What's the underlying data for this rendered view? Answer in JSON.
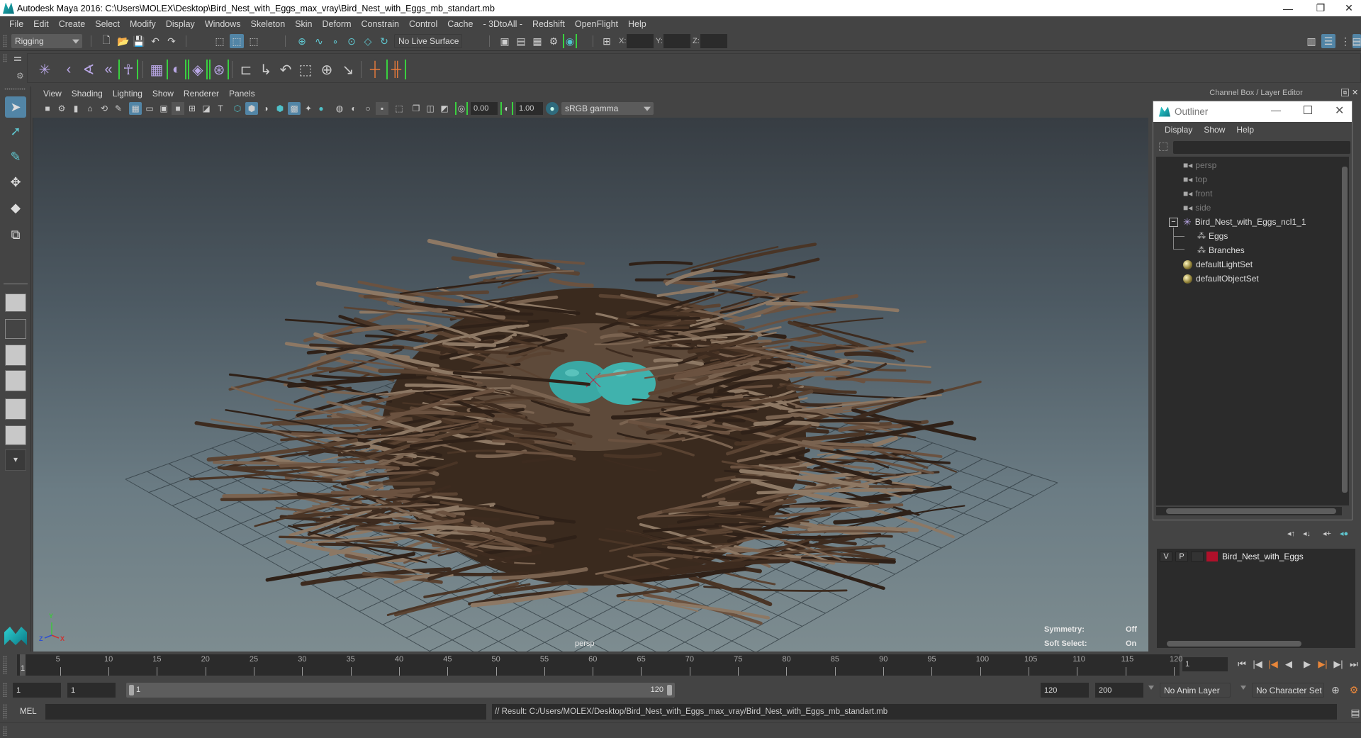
{
  "window": {
    "title": "Autodesk Maya 2016: C:\\Users\\MOLEX\\Desktop\\Bird_Nest_with_Eggs_max_vray\\Bird_Nest_with_Eggs_mb_standart.mb",
    "controls": {
      "minimize": "—",
      "restore": "❐",
      "close": "✕"
    }
  },
  "menubar": [
    "File",
    "Edit",
    "Create",
    "Select",
    "Modify",
    "Display",
    "Windows",
    "Skeleton",
    "Skin",
    "Deform",
    "Constrain",
    "Control",
    "Cache",
    "- 3DtoAll -",
    "Redshift",
    "OpenFlight",
    "Help"
  ],
  "statusline": {
    "menu_set": "Rigging",
    "live_surface": "No Live Surface",
    "x_label": "X:",
    "y_label": "Y:",
    "z_label": "Z:",
    "x_value": "",
    "y_value": "",
    "z_value": ""
  },
  "shelf": {
    "icons": [
      "joint-tool",
      "ik-handle",
      "ik-spline",
      "insert-joint",
      "humanik",
      "paint-skin-weights",
      "bind-skin",
      "wrap",
      "lattice",
      "parent",
      "parent-constraint",
      "point-constraint",
      "orient-constraint",
      "scale-constraint",
      "aim-constraint",
      "pole-vector",
      "key-frame",
      "set-key"
    ]
  },
  "toolbox": {
    "tools": [
      "select-tool",
      "lasso-tool",
      "paint-select-tool",
      "move-tool",
      "rotate-tool",
      "scale-tool"
    ]
  },
  "panel": {
    "menu": [
      "View",
      "Shading",
      "Lighting",
      "Show",
      "Renderer",
      "Panels"
    ],
    "exposure": "0.00",
    "gamma": "1.00",
    "color_space": "sRGB gamma",
    "camera_label": "persp",
    "hud": {
      "symmetry_label": "Symmetry:",
      "symmetry_value": "Off",
      "soft_select_label": "Soft Select:",
      "soft_select_value": "On"
    },
    "axis": {
      "x": "X",
      "y": "Y",
      "z": "Z"
    }
  },
  "dock": {
    "header": "Channel Box / Layer Editor"
  },
  "outliner": {
    "title": "Outliner",
    "menu": [
      "Display",
      "Show",
      "Help"
    ],
    "search_value": "",
    "nodes": [
      {
        "label": "persp",
        "type": "camera",
        "depth": 0
      },
      {
        "label": "top",
        "type": "camera",
        "depth": 0
      },
      {
        "label": "front",
        "type": "camera",
        "depth": 0
      },
      {
        "label": "side",
        "type": "camera",
        "depth": 0
      },
      {
        "label": "Bird_Nest_with_Eggs_ncl1_1",
        "type": "group",
        "depth": 0,
        "expanded": true
      },
      {
        "label": "Eggs",
        "type": "mesh",
        "depth": 1
      },
      {
        "label": "Branches",
        "type": "mesh",
        "depth": 1
      },
      {
        "label": "defaultLightSet",
        "type": "set",
        "depth": 0
      },
      {
        "label": "defaultObjectSet",
        "type": "set",
        "depth": 0
      }
    ]
  },
  "layers": {
    "items": [
      {
        "visible": "V",
        "playback": "P",
        "name": "Bird_Nest_with_Eggs",
        "color": "#b0102a"
      }
    ]
  },
  "timeslider": {
    "ticks": [
      5,
      10,
      15,
      20,
      25,
      30,
      35,
      40,
      45,
      50,
      55,
      60,
      65,
      70,
      75,
      80,
      85,
      90,
      95,
      100,
      105,
      110,
      115,
      120
    ],
    "current_frame_marker": "1",
    "range_min": 1,
    "range_max": 120,
    "current_frame": "1"
  },
  "rangeslider": {
    "start_time": "1",
    "playback_start": "1",
    "range_start_label": "1",
    "range_end_label": "120",
    "playback_end": "120",
    "end_time": "200",
    "anim_layer": "No Anim Layer",
    "character_set": "No Character Set"
  },
  "cmdline": {
    "label": "MEL",
    "input_value": "",
    "result": "// Result: C:/Users/MOLEX/Desktop/Bird_Nest_with_Eggs_max_vray/Bird_Nest_with_Eggs_mb_standart.mb"
  },
  "colors": {
    "accent_selected": "#5285a6",
    "bracket_green": "#39d13f",
    "layer_red": "#b0102a",
    "egg_teal": "#3aa8a4",
    "nest_brown": "#4a3526"
  }
}
